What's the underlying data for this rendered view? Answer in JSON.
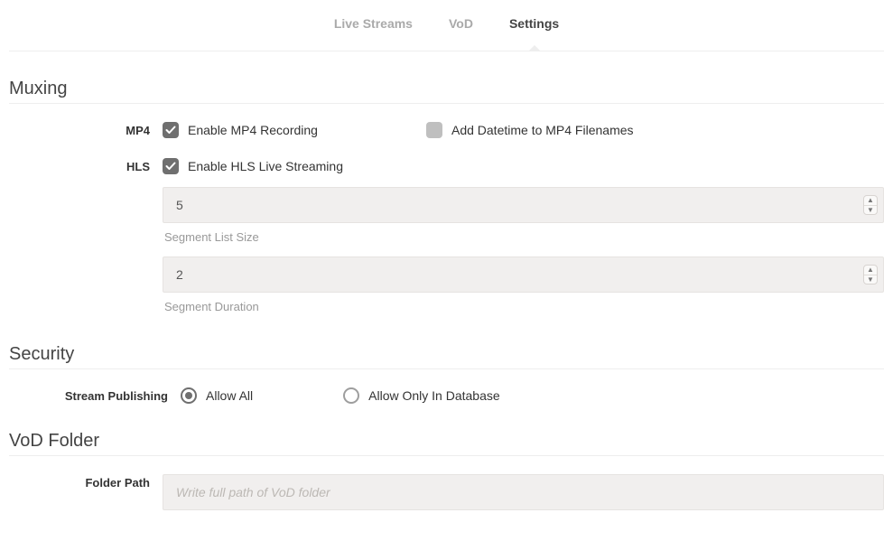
{
  "tabs": {
    "live_streams": "Live Streams",
    "vod": "VoD",
    "settings": "Settings"
  },
  "sections": {
    "muxing": {
      "title": "Muxing"
    },
    "security": {
      "title": "Security"
    },
    "vod_folder": {
      "title": "VoD Folder"
    }
  },
  "muxing": {
    "mp4": {
      "label": "MP4",
      "enable_recording": {
        "label": "Enable MP4 Recording",
        "checked": true
      },
      "add_datetime": {
        "label": "Add Datetime to MP4 Filenames",
        "checked": false
      }
    },
    "hls": {
      "label": "HLS",
      "enable_streaming": {
        "label": "Enable HLS Live Streaming",
        "checked": true
      },
      "segment_list_size": {
        "value": "5",
        "help": "Segment List Size"
      },
      "segment_duration": {
        "value": "2",
        "help": "Segment Duration"
      }
    }
  },
  "security": {
    "stream_publishing": {
      "label": "Stream Publishing",
      "allow_all": {
        "label": "Allow All",
        "selected": true
      },
      "allow_only_db": {
        "label": "Allow Only In Database",
        "selected": false
      }
    }
  },
  "vod_folder": {
    "folder_path": {
      "label": "Folder Path",
      "placeholder": "Write full path of VoD folder",
      "value": ""
    }
  }
}
